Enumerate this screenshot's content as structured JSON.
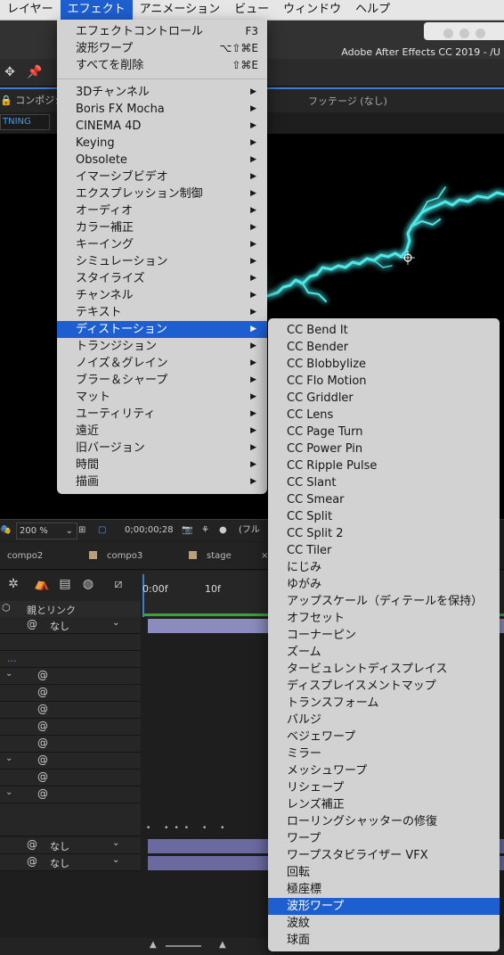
{
  "menubar": {
    "items": [
      {
        "label": "レイヤー",
        "active": false
      },
      {
        "label": "エフェクト",
        "active": true
      },
      {
        "label": "アニメーション",
        "active": false
      },
      {
        "label": "ビュー",
        "active": false
      },
      {
        "label": "ウィンドウ",
        "active": false
      },
      {
        "label": "ヘルプ",
        "active": false
      }
    ]
  },
  "window": {
    "title": "Adobe After Effects CC 2019 - /U"
  },
  "panels": {
    "comp_tab": "コンポジシ",
    "footage_tab": "フッテージ (なし)",
    "comp_chip": "TNING"
  },
  "viewer_bar": {
    "zoom": "200 %",
    "timecode": "0;00;00;28",
    "resolution": "(フル"
  },
  "timeline": {
    "tabs": [
      "compo2",
      "compo3",
      "stage"
    ],
    "ruler_start": "0:00f",
    "ruler_mark": "10f",
    "header_label": "親とリンク",
    "layer_parent": "なし",
    "ellipsis": "..."
  },
  "effect_menu": {
    "top_items": [
      {
        "label": "エフェクトコントロール",
        "shortcut": "F3"
      },
      {
        "label": "波形ワープ",
        "shortcut": "⌥⇧⌘E"
      },
      {
        "label": "すべてを削除",
        "shortcut": "⇧⌘E"
      }
    ],
    "categories": [
      "3Dチャンネル",
      "Boris FX Mocha",
      "CINEMA 4D",
      "Keying",
      "Obsolete",
      "イマーシブビデオ",
      "エクスプレッション制御",
      "オーディオ",
      "カラー補正",
      "キーイング",
      "シミュレーション",
      "スタイライズ",
      "チャンネル",
      "テキスト",
      "ディストーション",
      "トランジション",
      "ノイズ＆グレイン",
      "ブラー＆シャープ",
      "マット",
      "ユーティリティ",
      "遠近",
      "旧バージョン",
      "時間",
      "描画"
    ],
    "highlighted": "ディストーション"
  },
  "distortion_submenu": {
    "items": [
      "CC Bend It",
      "CC Bender",
      "CC Blobbylize",
      "CC Flo Motion",
      "CC Griddler",
      "CC Lens",
      "CC Page Turn",
      "CC Power Pin",
      "CC Ripple Pulse",
      "CC Slant",
      "CC Smear",
      "CC Split",
      "CC Split 2",
      "CC Tiler",
      "にじみ",
      "ゆがみ",
      "アップスケール（ディテールを保持）",
      "オフセット",
      "コーナーピン",
      "ズーム",
      "タービュレントディスプレイス",
      "ディスプレイスメントマップ",
      "トランスフォーム",
      "バルジ",
      "ベジェワープ",
      "ミラー",
      "メッシュワープ",
      "リシェープ",
      "レンズ補正",
      "ローリングシャッターの修復",
      "ワープ",
      "ワープスタビライザー VFX",
      "回転",
      "極座標",
      "波形ワープ",
      "波紋",
      "球面"
    ],
    "highlighted": "波形ワープ"
  },
  "colors": {
    "menu_bg": "#d2d2d2",
    "highlight": "#1d5fd1",
    "lightning": "#4ee8e8"
  }
}
